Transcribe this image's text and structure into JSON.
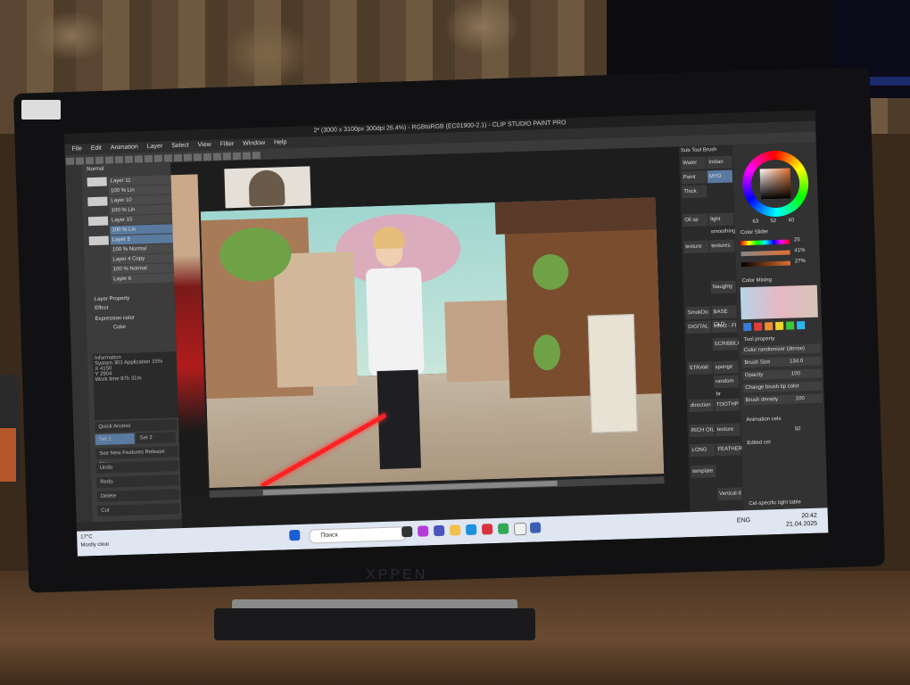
{
  "window": {
    "title": "2* (3000 x 3100px 300dpi 26.4%) - RGBtoRGB (EC01900-2.1) - CLIP STUDIO PAINT PRO"
  },
  "menu": {
    "items": [
      "File",
      "Edit",
      "Animation",
      "Layer",
      "Select",
      "View",
      "Filter",
      "Window",
      "Help"
    ]
  },
  "layers": {
    "blend_mode": "Normal",
    "rows": [
      {
        "label": "Layer 11"
      },
      {
        "label": "100 % Lin"
      },
      {
        "label": "Layer 10"
      },
      {
        "label": "100 % Lin"
      },
      {
        "label": "Layer 15"
      },
      {
        "label": "100 % Lin"
      },
      {
        "label": "Layer 3"
      },
      {
        "label": "100 % Normal"
      },
      {
        "label": "Layer 4 Copy"
      },
      {
        "label": "100 % Normal"
      },
      {
        "label": "Layer 6"
      }
    ],
    "layer_property": "Layer Property",
    "effect": "Effect",
    "expression_color": "Expression color",
    "color_value": "Color"
  },
  "info": {
    "header": "Information",
    "system": "System",
    "system_val": "301",
    "application": "Application",
    "application_pct": "15%",
    "x_label": "X",
    "x_val": "4150",
    "y_label": "Y",
    "y_val": "2904",
    "work_time": "Work time",
    "work_time_val": "87h 31m",
    "quick_access": "Quick Access",
    "set1": "Set 1",
    "set2": "Set 2",
    "see_new": "See New Features Release Notes",
    "undo": "Undo",
    "redo": "Redo",
    "delete": "Delete",
    "cut": "Cut"
  },
  "brushes": {
    "header": "Sub Tool Brush",
    "items": [
      "Water",
      "Paint",
      "Thick",
      "Oil sp",
      "texture",
      "DIGITAL",
      "SmokDo",
      "STRAW",
      "direction",
      "RICH OIL",
      "LONG",
      "template",
      "Vertical d"
    ],
    "right_items": [
      "Indian",
      "MYO",
      "light smoothing",
      "textures",
      "Naughty",
      "effect - Fl",
      "BASE CLO",
      "SCRIBBLE",
      "sponge",
      "random br",
      "TOOTHP",
      "texture",
      "FEATHER"
    ]
  },
  "color": {
    "wheel_values": [
      "63",
      "52",
      "40"
    ],
    "slider_header": "Color Slider",
    "slider_values": [
      "25",
      "41%",
      "27%"
    ],
    "mixing_header": "Color Mixing",
    "tool_property_header": "Tool property",
    "tool_property_name": "Color randomizer (dense)",
    "brush_size_label": "Brush Size",
    "brush_size_val": "134.0",
    "opacity_label": "Opacity",
    "opacity_val": "100",
    "change_tip_label": "Change brush tip color",
    "brush_density_label": "Brush density",
    "brush_density_val": "100",
    "anim_header": "Animation cels",
    "anim_val": "50",
    "edited_cel": "Edited cel",
    "footer": "Cel-specific light table"
  },
  "taskbar": {
    "weather_temp": "17°C",
    "weather_desc": "Mostly clear",
    "search_placeholder": "Поиск",
    "lang": "ENG",
    "time": "20:42",
    "date": "21.04.2025"
  },
  "device": {
    "brand": "XPPEN"
  }
}
